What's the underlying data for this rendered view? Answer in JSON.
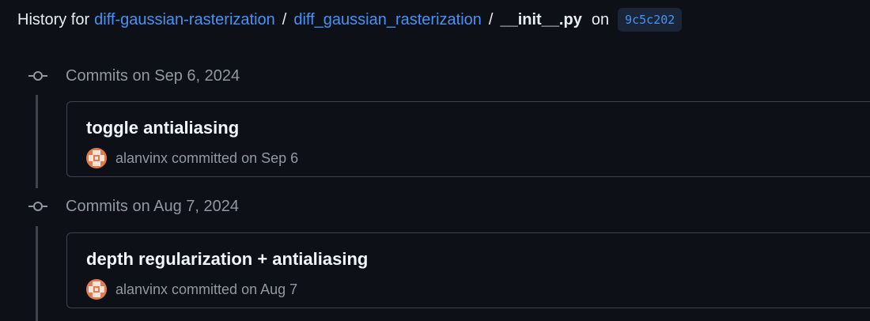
{
  "header": {
    "prefix": "History for",
    "repo_link": "diff-gaussian-rasterization",
    "separator_1": "/",
    "folder_link": "diff_gaussian_rasterization",
    "separator_2": "/",
    "file_name": "__init__.py",
    "on_label": "on",
    "commit_sha": "9c5c202"
  },
  "groups": [
    {
      "title": "Commits on Sep 6, 2024",
      "commits": [
        {
          "message": "toggle antialiasing",
          "author": "alanvinx",
          "meta": "committed on Sep 6"
        }
      ]
    },
    {
      "title": "Commits on Aug 7, 2024",
      "commits": [
        {
          "message": "depth regularization + antialiasing",
          "author": "alanvinx",
          "meta": "committed on Aug 7"
        }
      ]
    }
  ],
  "icons": {
    "group_icon": "git-commit-icon",
    "avatar": "user-avatar"
  },
  "colors": {
    "background": "#0d1117",
    "link": "#4493f8",
    "muted_text": "#9198a1",
    "border": "#3d444d",
    "avatar": "#e37b4f"
  }
}
